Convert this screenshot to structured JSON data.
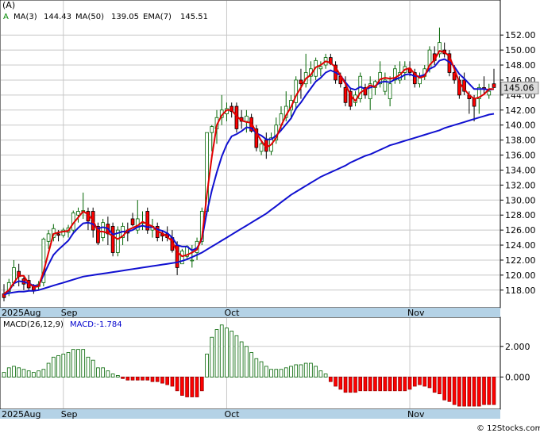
{
  "header": {
    "symbol_label": "(A)",
    "legend_marker": "A",
    "ma3_label": "MA(3)",
    "ma3_value": "144.43",
    "ma50_label": "MA(50)",
    "ma50_value": "139.05",
    "ema7_label": "EMA(7)",
    "ema7_value": "145.51"
  },
  "last_price": "145.06",
  "macd_label": "MACD(26,12,9)",
  "macd_value_label": "MACD:-1.784",
  "watermark": "© 12Stocks.com",
  "colors": {
    "up_candle": "#ffffff",
    "up_outline": "#006400",
    "down_candle": "#ff0000",
    "ma_blue": "#1010d0",
    "ema_red": "#e00000",
    "axis_band": "#b4d2e6",
    "grid": "#c8c8c8",
    "hist_pos": "#006400",
    "hist_neg": "#ff0000"
  },
  "chart_data": [
    {
      "type": "candlestick",
      "title": "(A)",
      "ylim": [
        116.5,
        153.5
      ],
      "yticks": [
        118,
        120,
        122,
        124,
        126,
        128,
        130,
        132,
        134,
        136,
        138,
        140,
        142,
        144,
        146,
        148,
        150,
        152
      ],
      "x_labels": [
        {
          "label": "2025Aug",
          "index": 0
        },
        {
          "label": "Sep",
          "index": 12
        },
        {
          "label": "Oct",
          "index": 45
        },
        {
          "label": "Nov",
          "index": 82
        }
      ],
      "candles": [
        [
          117.5,
          118.8,
          116.5,
          117.0
        ],
        [
          117.8,
          119.5,
          117.2,
          119.0
        ],
        [
          119.0,
          122.0,
          118.5,
          121.0
        ],
        [
          120.5,
          121.5,
          118.5,
          119.8
        ],
        [
          119.5,
          119.9,
          118.0,
          118.8
        ],
        [
          119.3,
          120.0,
          118.0,
          118.3
        ],
        [
          118.5,
          118.8,
          117.5,
          118.0
        ],
        [
          118.5,
          119.2,
          118.0,
          118.8
        ],
        [
          119.0,
          125.0,
          118.5,
          124.8
        ],
        [
          124.5,
          126.0,
          123.5,
          125.5
        ],
        [
          125.0,
          126.8,
          124.5,
          126.2
        ],
        [
          125.5,
          126.0,
          124.5,
          125.3
        ],
        [
          125.3,
          126.3,
          125.0,
          126.0
        ],
        [
          125.7,
          126.7,
          125.0,
          126.3
        ],
        [
          126.0,
          128.6,
          125.5,
          128.3
        ],
        [
          128.0,
          129.0,
          127.0,
          128.5
        ],
        [
          128.5,
          131.0,
          127.5,
          128.6
        ],
        [
          128.5,
          129.0,
          126.0,
          127.2
        ],
        [
          128.5,
          129.0,
          125.0,
          126.0
        ],
        [
          126.5,
          127.0,
          124.0,
          124.3
        ],
        [
          125.0,
          127.5,
          124.5,
          127.0
        ],
        [
          126.8,
          127.8,
          124.0,
          125.5
        ],
        [
          126.5,
          127.0,
          122.5,
          123.0
        ],
        [
          123.0,
          126.5,
          122.5,
          126.0
        ],
        [
          125.0,
          127.0,
          124.0,
          126.5
        ],
        [
          126.0,
          127.0,
          124.5,
          125.6
        ],
        [
          127.5,
          128.3,
          126.5,
          126.7
        ],
        [
          126.0,
          130.0,
          125.5,
          127.5
        ],
        [
          127.0,
          128.5,
          126.0,
          127.0
        ],
        [
          128.5,
          129.0,
          125.5,
          126.0
        ],
        [
          126.0,
          127.5,
          125.0,
          126.5
        ],
        [
          126.5,
          127.0,
          124.5,
          125.0
        ],
        [
          125.5,
          126.0,
          124.5,
          125.2
        ],
        [
          125.5,
          126.5,
          124.5,
          125.0
        ],
        [
          125.0,
          126.0,
          123.0,
          123.3
        ],
        [
          124.0,
          124.5,
          120.0,
          121.0
        ],
        [
          121.5,
          123.5,
          121.5,
          123.2
        ],
        [
          122.5,
          124.0,
          122.0,
          123.8
        ],
        [
          122.0,
          124.0,
          121.0,
          122.0
        ],
        [
          123.0,
          125.0,
          122.0,
          124.5
        ],
        [
          124.5,
          129.0,
          124.0,
          128.5
        ],
        [
          128.5,
          139.0,
          128.0,
          139.0
        ],
        [
          139.0,
          140.0,
          136.5,
          139.8
        ],
        [
          139.5,
          142.0,
          137.5,
          141.0
        ],
        [
          141.0,
          144.0,
          140.0,
          142.0
        ],
        [
          141.5,
          143.0,
          140.5,
          142.2
        ],
        [
          142.5,
          143.0,
          141.0,
          141.8
        ],
        [
          142.5,
          143.0,
          139.0,
          139.5
        ],
        [
          141.0,
          142.0,
          139.5,
          140.5
        ],
        [
          140.5,
          142.0,
          139.0,
          141.2
        ],
        [
          141.0,
          141.5,
          139.0,
          139.2
        ],
        [
          139.5,
          140.0,
          136.5,
          137.0
        ],
        [
          136.5,
          138.0,
          136.0,
          137.5
        ],
        [
          138.0,
          139.0,
          135.5,
          136.5
        ],
        [
          136.5,
          139.0,
          136.0,
          138.3
        ],
        [
          138.0,
          141.0,
          137.5,
          140.0
        ],
        [
          140.0,
          142.5,
          139.5,
          141.5
        ],
        [
          141.0,
          144.5,
          140.5,
          142.5
        ],
        [
          142.0,
          144.0,
          141.0,
          143.3
        ],
        [
          143.0,
          146.5,
          142.0,
          146.0
        ],
        [
          146.0,
          147.5,
          143.5,
          145.5
        ],
        [
          145.5,
          149.5,
          145.0,
          147.0
        ],
        [
          146.5,
          148.5,
          145.5,
          147.5
        ],
        [
          146.5,
          149.0,
          146.0,
          148.6
        ],
        [
          147.5,
          148.5,
          146.5,
          147.8
        ],
        [
          148.0,
          149.5,
          147.5,
          149.0
        ],
        [
          149.0,
          149.5,
          148.0,
          148.2
        ],
        [
          148.0,
          148.5,
          145.5,
          146.0
        ],
        [
          146.5,
          147.0,
          145.0,
          145.5
        ],
        [
          145.0,
          146.5,
          142.5,
          143.0
        ],
        [
          144.5,
          145.0,
          142.0,
          142.5
        ],
        [
          143.0,
          144.5,
          142.5,
          144.0
        ],
        [
          143.5,
          147.0,
          143.0,
          146.5
        ],
        [
          145.0,
          145.5,
          143.5,
          144.0
        ],
        [
          143.5,
          146.5,
          142.0,
          145.5
        ],
        [
          145.0,
          146.0,
          144.0,
          145.8
        ],
        [
          145.5,
          148.5,
          145.0,
          147.0
        ],
        [
          144.5,
          147.0,
          144.0,
          146.0
        ],
        [
          143.5,
          146.5,
          142.5,
          145.5
        ],
        [
          146.0,
          148.0,
          145.5,
          147.5
        ],
        [
          146.0,
          148.5,
          145.5,
          147.0
        ],
        [
          147.0,
          148.5,
          146.0,
          147.8
        ],
        [
          147.5,
          148.5,
          146.5,
          147.0
        ],
        [
          147.0,
          147.5,
          145.0,
          145.5
        ],
        [
          145.5,
          147.0,
          145.0,
          146.5
        ],
        [
          146.5,
          148.0,
          146.0,
          147.5
        ],
        [
          147.5,
          150.5,
          147.0,
          150.0
        ],
        [
          149.5,
          150.5,
          148.0,
          148.6
        ],
        [
          149.5,
          153.0,
          149.0,
          151.0
        ],
        [
          150.0,
          151.0,
          149.0,
          149.5
        ],
        [
          149.5,
          150.0,
          146.5,
          147.0
        ],
        [
          147.0,
          148.0,
          145.5,
          146.0
        ],
        [
          146.0,
          146.5,
          143.5,
          144.0
        ],
        [
          146.0,
          147.0,
          144.0,
          144.5
        ],
        [
          144.0,
          144.5,
          141.5,
          143.5
        ],
        [
          143.5,
          144.0,
          140.5,
          142.5
        ],
        [
          143.5,
          145.5,
          141.5,
          145.0
        ],
        [
          145.0,
          146.5,
          144.0,
          144.8
        ],
        [
          144.0,
          145.5,
          143.5,
          144.5
        ],
        [
          145.5,
          147.5,
          145.0,
          145.0
        ]
      ],
      "series": [
        {
          "name": "MA(3)",
          "color": "#e00000",
          "values": [
            117.5,
            118.0,
            119.0,
            119.9,
            119.9,
            118.9,
            118.4,
            118.5,
            120.5,
            123.0,
            125.5,
            125.7,
            125.8,
            125.9,
            126.9,
            127.7,
            128.5,
            128.1,
            127.3,
            125.8,
            125.8,
            125.6,
            125.2,
            124.8,
            125.2,
            126.0,
            126.3,
            126.6,
            127.1,
            126.8,
            126.5,
            125.8,
            125.6,
            125.1,
            124.5,
            123.1,
            122.5,
            122.7,
            123.0,
            123.4,
            125.0,
            130.7,
            135.8,
            140.0,
            141.3,
            142.0,
            142.0,
            141.2,
            140.6,
            140.4,
            140.3,
            139.0,
            137.9,
            137.0,
            137.4,
            138.3,
            139.9,
            141.3,
            142.4,
            143.9,
            145.0,
            146.2,
            146.7,
            147.7,
            148.0,
            148.5,
            148.3,
            147.7,
            146.6,
            145.5,
            144.0,
            143.2,
            144.3,
            144.8,
            145.3,
            145.1,
            146.1,
            146.3,
            146.2,
            146.3,
            146.7,
            147.4,
            147.6,
            146.8,
            146.3,
            146.5,
            148.0,
            148.7,
            149.9,
            149.7,
            149.2,
            147.5,
            145.7,
            144.8,
            144.0,
            143.5,
            143.7,
            144.1,
            144.8,
            144.8
          ]
        },
        {
          "name": "MA(50)",
          "color": "#1010d0",
          "values": [
            117.4,
            117.6,
            117.7,
            117.8,
            117.8,
            117.9,
            117.9,
            118.0,
            118.2,
            118.4,
            118.6,
            118.8,
            119.0,
            119.2,
            119.4,
            119.6,
            119.8,
            119.9,
            120.0,
            120.1,
            120.2,
            120.3,
            120.4,
            120.5,
            120.6,
            120.7,
            120.8,
            120.9,
            121.0,
            121.1,
            121.2,
            121.3,
            121.4,
            121.5,
            121.6,
            121.7,
            121.9,
            122.1,
            122.4,
            122.7,
            123.0,
            123.4,
            123.8,
            124.2,
            124.6,
            125.0,
            125.4,
            125.8,
            126.2,
            126.6,
            127.0,
            127.4,
            127.8,
            128.2,
            128.7,
            129.2,
            129.7,
            130.2,
            130.7,
            131.1,
            131.5,
            131.9,
            132.3,
            132.7,
            133.1,
            133.4,
            133.7,
            134.0,
            134.3,
            134.6,
            135.0,
            135.3,
            135.6,
            135.9,
            136.1,
            136.4,
            136.7,
            137.0,
            137.3,
            137.5,
            137.7,
            137.9,
            138.1,
            138.3,
            138.5,
            138.7,
            138.9,
            139.1,
            139.3,
            139.6,
            139.8,
            140.0,
            140.2,
            140.4,
            140.6,
            140.8,
            141.0,
            141.2,
            141.4,
            141.5
          ]
        },
        {
          "name": "EMA(7)",
          "color": "#1010d0",
          "values": [
            117.5,
            117.9,
            118.9,
            119.2,
            119.1,
            118.9,
            118.6,
            118.6,
            120.0,
            121.4,
            122.7,
            123.4,
            124.0,
            124.6,
            125.6,
            126.3,
            126.9,
            127.0,
            126.8,
            126.2,
            126.4,
            126.2,
            125.4,
            125.6,
            125.8,
            125.8,
            126.0,
            126.4,
            126.6,
            126.4,
            126.4,
            126.1,
            125.9,
            125.6,
            125.0,
            124.0,
            123.8,
            123.8,
            123.3,
            123.6,
            124.8,
            128.4,
            131.3,
            133.7,
            135.8,
            137.4,
            138.5,
            138.8,
            139.2,
            139.7,
            139.6,
            138.9,
            138.6,
            138.1,
            138.1,
            138.6,
            139.3,
            140.1,
            140.9,
            142.2,
            143.0,
            144.0,
            144.9,
            145.8,
            146.3,
            147.0,
            147.3,
            147.0,
            146.6,
            145.7,
            144.9,
            144.7,
            145.1,
            144.8,
            145.0,
            145.2,
            145.7,
            145.8,
            145.7,
            146.1,
            146.3,
            146.7,
            146.8,
            146.5,
            146.5,
            146.7,
            147.5,
            147.8,
            148.6,
            148.8,
            148.4,
            147.8,
            146.8,
            146.2,
            145.5,
            144.8,
            144.8,
            144.8,
            144.7,
            144.8
          ]
        }
      ]
    },
    {
      "type": "bar",
      "title": "MACD(26,12,9)",
      "yticks": [
        {
          "value": 2.0,
          "label": "2.000"
        },
        {
          "value": 0.0,
          "label": "0.000"
        }
      ],
      "ylim": [
        -2.0,
        3.7
      ],
      "x_labels": [
        {
          "label": "2025Aug",
          "index": 0
        },
        {
          "label": "Sep",
          "index": 12
        },
        {
          "label": "Oct",
          "index": 45
        },
        {
          "label": "Nov",
          "index": 82
        }
      ],
      "values": [
        0.3,
        0.6,
        0.7,
        0.6,
        0.5,
        0.4,
        0.3,
        0.4,
        0.5,
        0.9,
        1.3,
        1.4,
        1.5,
        1.6,
        1.8,
        1.8,
        1.8,
        1.3,
        1.1,
        0.6,
        0.6,
        0.4,
        0.2,
        0.1,
        -0.1,
        -0.2,
        -0.2,
        -0.2,
        -0.2,
        -0.2,
        -0.3,
        -0.3,
        -0.4,
        -0.5,
        -0.6,
        -0.9,
        -1.2,
        -1.3,
        -1.3,
        -1.3,
        -0.9,
        1.5,
        2.6,
        3.1,
        3.4,
        3.2,
        3.0,
        2.7,
        2.3,
        2.0,
        1.6,
        1.2,
        1.0,
        0.7,
        0.5,
        0.5,
        0.5,
        0.6,
        0.7,
        0.8,
        0.8,
        0.9,
        0.9,
        0.7,
        0.4,
        0.2,
        -0.3,
        -0.6,
        -0.8,
        -1.0,
        -1.0,
        -1.0,
        -0.9,
        -0.9,
        -0.9,
        -0.9,
        -0.9,
        -0.9,
        -0.9,
        -0.9,
        -0.9,
        -0.9,
        -0.8,
        -0.6,
        -0.5,
        -0.6,
        -0.7,
        -1.0,
        -1.1,
        -1.5,
        -1.6,
        -1.8,
        -1.9,
        -1.9,
        -1.9,
        -1.9,
        -1.9,
        -1.8,
        -1.8,
        -1.8
      ]
    }
  ]
}
